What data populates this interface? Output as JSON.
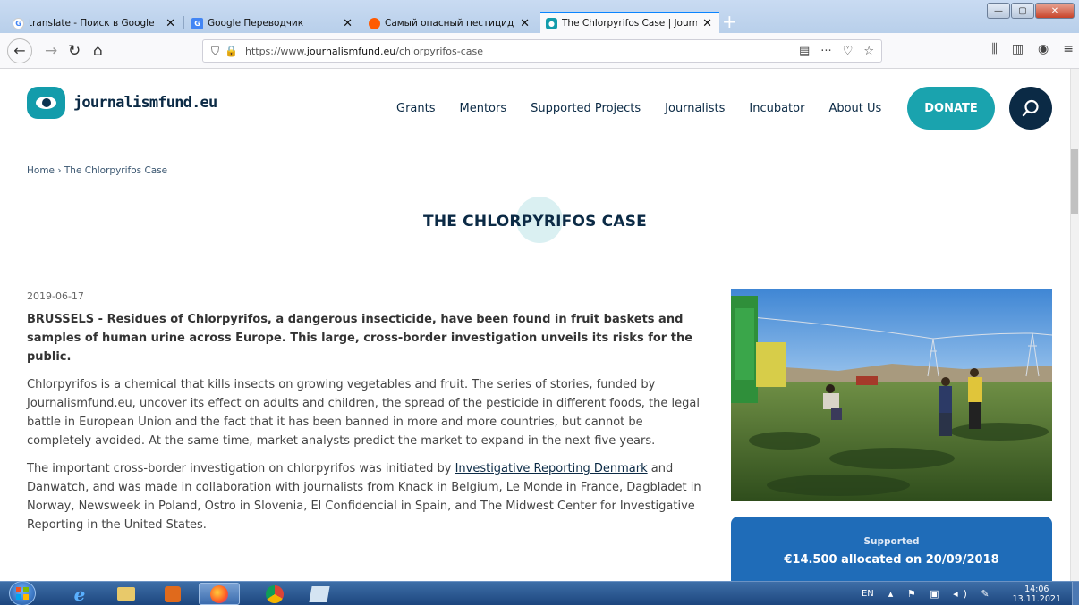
{
  "browser": {
    "tabs": [
      {
        "title": "translate - Поиск в Google",
        "icon": "google-icon",
        "active": false
      },
      {
        "title": "Google Переводчик",
        "icon": "google-translate-icon",
        "active": false
      },
      {
        "title": "Самый опасный пестицид, о…",
        "icon": "opera-icon",
        "active": false
      },
      {
        "title": "The Chlorpyrifos Case | Journal…",
        "icon": "journalismfund-icon",
        "active": true
      }
    ],
    "new_tab_glyph": "+",
    "url_prefix": "https://www.",
    "url_domain": "journalismfund.eu",
    "url_path": "/chlorpyrifos-case",
    "window_buttons": {
      "minimize": "—",
      "maximize": "▢",
      "close": "✕"
    }
  },
  "site": {
    "logo_text": "journalismfund.eu",
    "nav": [
      "Grants",
      "Mentors",
      "Supported Projects",
      "Journalists",
      "Incubator",
      "About Us"
    ],
    "donate_label": "DONATE",
    "accent_color": "#1aa3ae",
    "navy_color": "#0b2a45"
  },
  "breadcrumb": {
    "home": "Home",
    "separator": " › ",
    "current": "The Chlorpyrifos Case"
  },
  "article": {
    "title": "THE CHLORPYRIFOS CASE",
    "date": "2019-06-17",
    "lead": "BRUSSELS - Residues of Chlorpyrifos, a dangerous insecticide, have been found in fruit baskets and samples of human urine across Europe. This large, cross-border investigation unveils its risks for the public.",
    "para1": "Chlorpyrifos is a chemical that kills insects on growing vegetables and fruit. The series of stories, funded by Journalismfund.eu, uncover its effect on adults and children, the spread of the pesticide in different foods, the legal battle in European Union and the fact that it has been banned in more and more countries, but cannot be completely avoided. At the same time, market analysts predict the market to expand in the next five years.",
    "para2_before": "The important cross-border investigation on chlorpyrifos was initiated by ",
    "para2_link": "Investigative Reporting Denmark",
    "para2_after": " and Danwatch, and was made in collaboration with journalists from Knack in Belgium, Le Monde in France, Dagbladet in Norway, Newsweek in Poland, Ostro in Slovenia, El Confidencial in Spain, and The Midwest Center for Investigative Reporting in the United States."
  },
  "sidebar": {
    "photo_alt": "field workers harvesting crops",
    "support_label": "Supported",
    "support_amount": "€14.500 allocated on 20/09/2018",
    "support_color": "#1f6cb8"
  },
  "taskbar": {
    "language": "EN",
    "time": "14:06",
    "date": "13.11.2021"
  }
}
